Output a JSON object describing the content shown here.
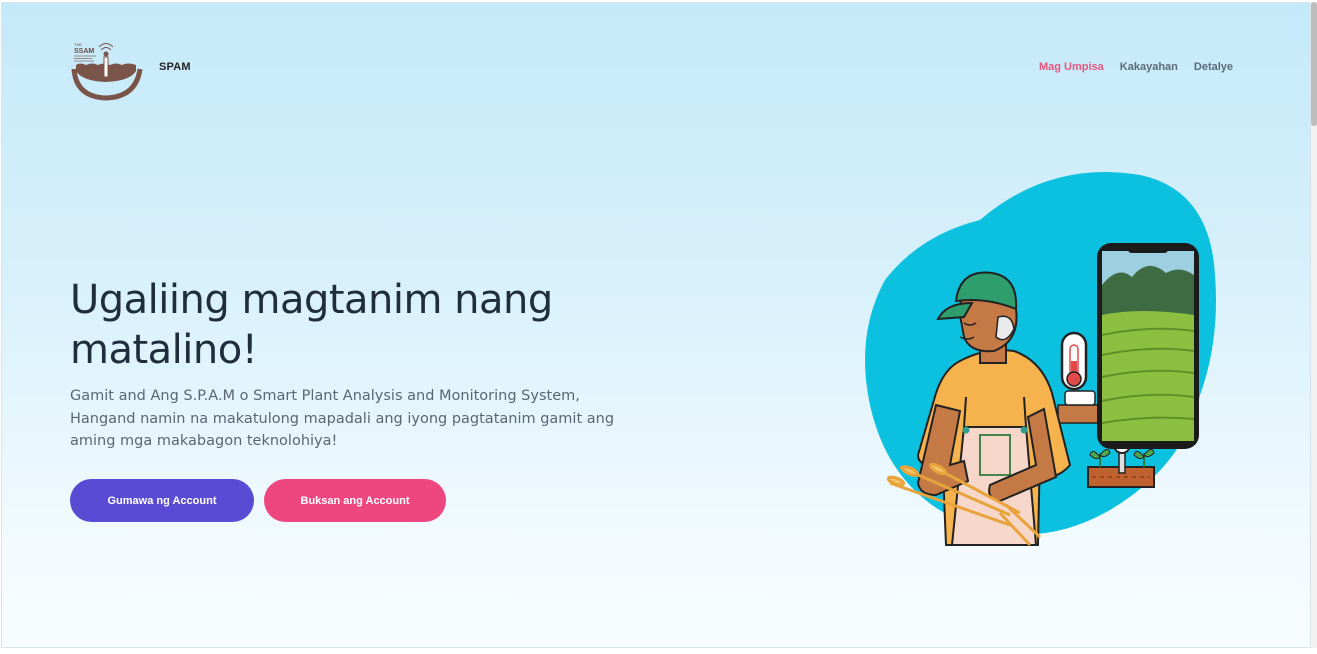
{
  "header": {
    "brand_name": "SPAM",
    "logo": {
      "icon": "soil-sensor-logo",
      "label_lines": [
        "THE",
        "SSAM"
      ]
    },
    "nav": [
      {
        "label": "Mag Umpisa",
        "active": true
      },
      {
        "label": "Kakayahan",
        "active": false
      },
      {
        "label": "Detalye",
        "active": false
      }
    ]
  },
  "hero": {
    "title": "Ugaliing magtanim nang matalino!",
    "description": "Gamit and Ang S.P.A.M o Smart Plant Analysis and Monitoring System, Hangand namin na makatulong mapadali ang iyong pagtatanim gamit ang aming mga makabagon teknolohiya!",
    "primary_button": "Gumawa ng Account",
    "secondary_button": "Buksan ang Account"
  },
  "illustration": {
    "subject": "farmer-with-smartphone-and-sensors",
    "elements": [
      "farmer-icon",
      "thermometer-icon",
      "smartphone-icon",
      "plant-sensor-icon",
      "wheat-icon"
    ]
  },
  "colors": {
    "accent_active": "#e8557e",
    "primary_button": "#5a4bd4",
    "secondary_button": "#ee4780",
    "blob": "#0cc1e0",
    "title_text": "#1f2d3d"
  }
}
